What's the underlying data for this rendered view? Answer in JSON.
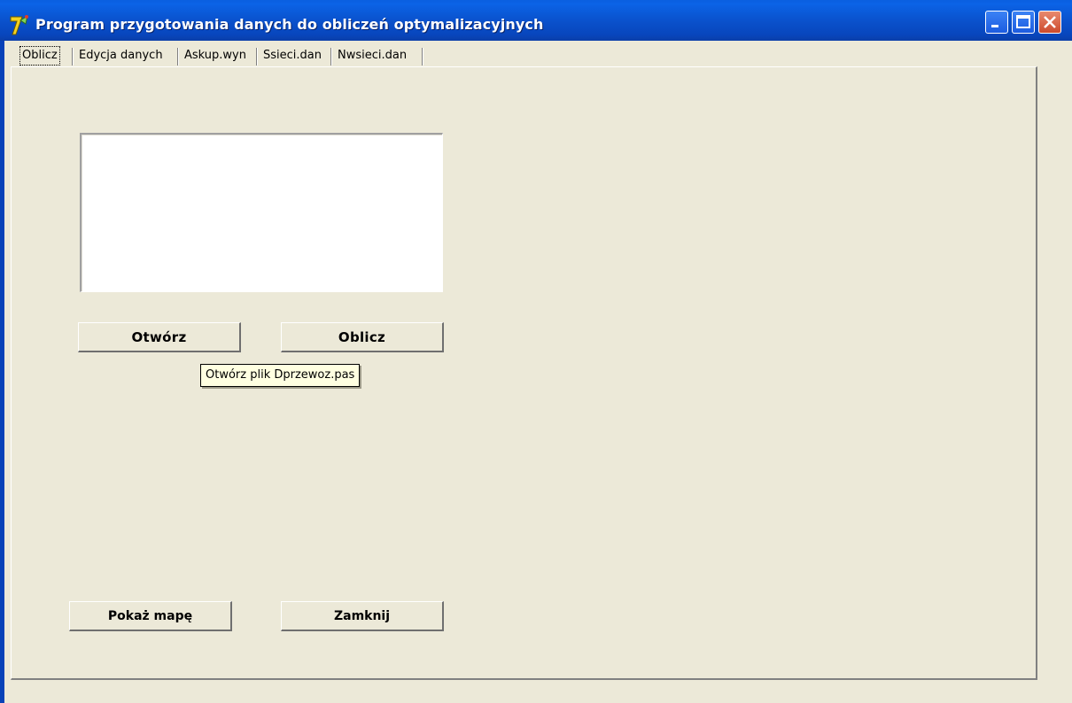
{
  "window": {
    "title": "Program przygotowania danych do obliczeń optymalizacyjnych",
    "icon": "delphi-app-icon"
  },
  "tabs": [
    {
      "label": "Oblicz",
      "active": true
    },
    {
      "label": "Edycja danych",
      "active": false
    },
    {
      "label": "Askup.wyn",
      "active": false
    },
    {
      "label": "Ssieci.dan",
      "active": false
    },
    {
      "label": "Nwsieci.dan",
      "active": false
    }
  ],
  "buttons": {
    "otworz": "Otwórz",
    "oblicz": "Oblicz",
    "pokaz_mape": "Pokaż mapę",
    "zamknij": "Zamknij"
  },
  "tooltip": "Otwórz plik Dprzewoz.pas",
  "colors": {
    "titlebar": "#0a52cd",
    "window_bg": "#ece9d8",
    "tooltip_bg": "#ffffe1"
  }
}
